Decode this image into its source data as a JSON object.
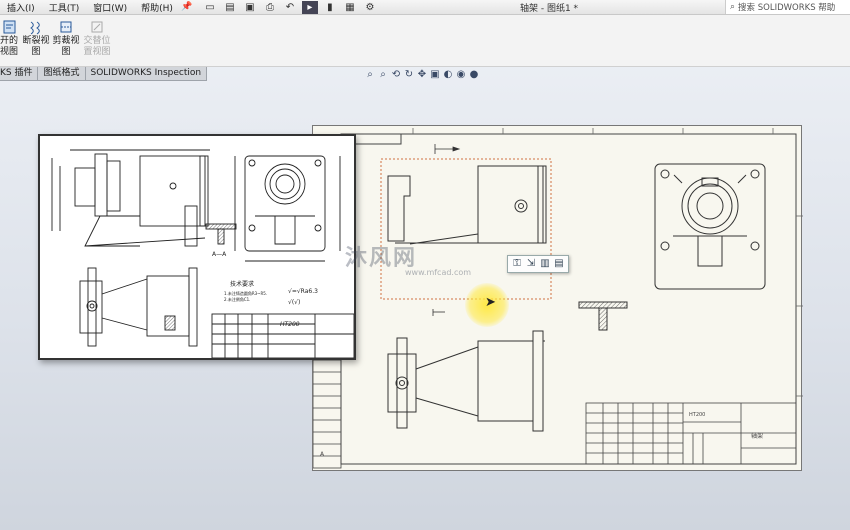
{
  "menu": {
    "items": [
      "插入(I)",
      "工具(T)",
      "窗口(W)",
      "帮助(H)"
    ]
  },
  "title_bar": {
    "document_title": "轴架 - 图纸1 *",
    "search_placeholder": "搜索 SOLIDWORKS 帮助"
  },
  "ribbon": {
    "buttons": [
      {
        "line1": "开的",
        "line2": "视图",
        "enabled": true
      },
      {
        "line1": "断裂视",
        "line2": "图",
        "enabled": true
      },
      {
        "line1": "剪裁视",
        "line2": "图",
        "enabled": true
      },
      {
        "line1": "交替位",
        "line2": "置视图",
        "enabled": false
      }
    ]
  },
  "tabs": [
    "KS 插件",
    "图纸格式",
    "SOLIDWORKS Inspection"
  ],
  "sheet": {
    "title_block_name": "轴架",
    "material_label": "HT200",
    "zone_label": "A"
  },
  "reference_drawing": {
    "section_label": "A—A",
    "material": "HT200",
    "notes_title": "技术要求",
    "note_lines": [
      "1.未注铸造圆角R3~R5.",
      "2.未注倒角C1."
    ],
    "roughness_1": "√=√Ra6.3",
    "roughness_2": "√(√)"
  },
  "watermark": {
    "text": "沐风网",
    "url": "www.mfcad.com"
  },
  "colors": {
    "accent": "#cc3a1a",
    "line": "#333333",
    "sheet_bg": "#f8f7ef",
    "cursor_highlight": "#ffe83c"
  }
}
